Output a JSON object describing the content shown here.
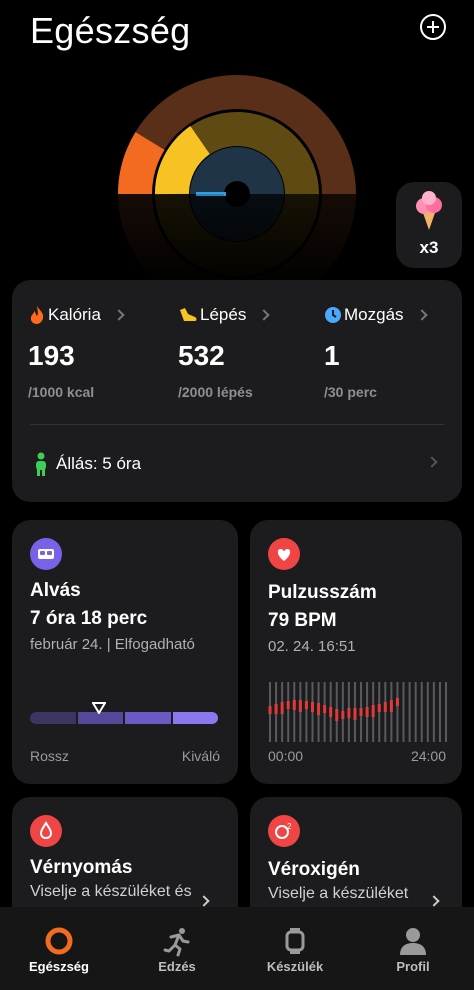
{
  "header": {
    "title": "Egészség"
  },
  "activity_rings": {
    "colors": [
      "#f26b21",
      "#f7c324",
      "#2f9ee8"
    ]
  },
  "reward": {
    "count": "x3"
  },
  "stats": [
    {
      "label": "Kalória",
      "value": "193",
      "goal": "/1000 kcal",
      "icon": "flame-icon",
      "color": "#ff6a1f"
    },
    {
      "label": "Lépés",
      "value": "532",
      "goal": "/2000 lépés",
      "icon": "shoe-icon",
      "color": "#f7c324"
    },
    {
      "label": "Mozgás",
      "value": "1",
      "goal": "/30 perc",
      "icon": "clock-icon",
      "color": "#4aa8ff"
    }
  ],
  "stand": {
    "label": "Állás: 5 óra"
  },
  "sleep": {
    "title": "Alvás",
    "value": "7 óra 18 perc",
    "detail": "február 24. | Elfogadható",
    "scale_low": "Rossz",
    "scale_high": "Kiváló"
  },
  "heart_rate": {
    "title": "Pulzusszám",
    "value": "79 BPM",
    "detail": "02. 24. 16:51",
    "x_start": "00:00",
    "x_end": "24:00"
  },
  "blood_pressure": {
    "title": "Vérnyomás",
    "desc": "Viselje a készüléket és"
  },
  "oxygen": {
    "title": "Véroxigén",
    "desc": "Viselje a készüléket"
  },
  "tabs": [
    {
      "label": "Egészség",
      "icon": "ring-icon",
      "active": true
    },
    {
      "label": "Edzés",
      "icon": "runner-icon",
      "active": false
    },
    {
      "label": "Készülék",
      "icon": "watch-icon",
      "active": false
    },
    {
      "label": "Profil",
      "icon": "person-icon",
      "active": false
    }
  ]
}
